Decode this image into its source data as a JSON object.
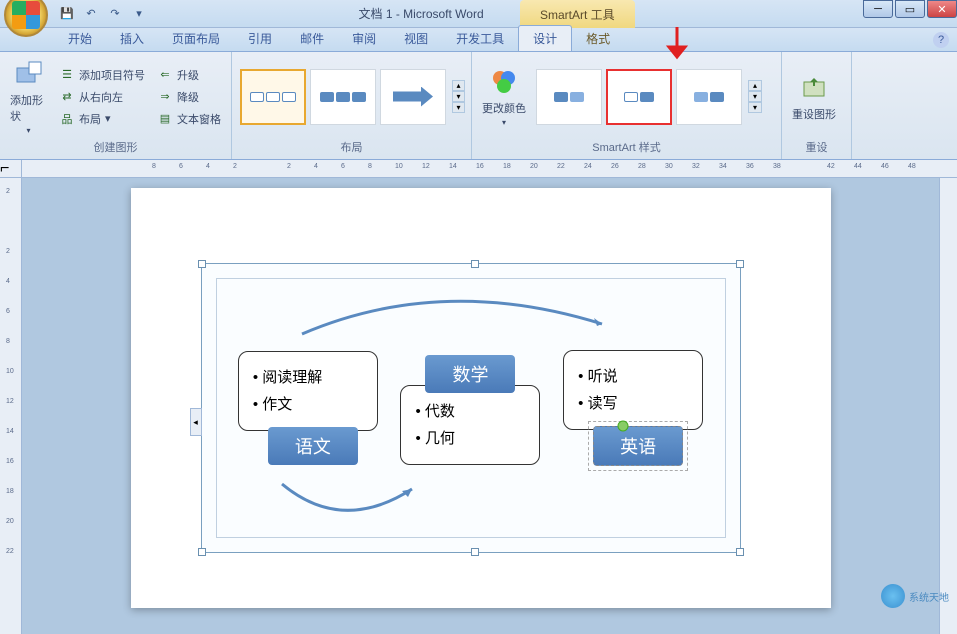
{
  "app": {
    "doc_title": "文档 1 - Microsoft Word",
    "context_tool": "SmartArt 工具"
  },
  "qat": {
    "save": "💾",
    "undo": "↶",
    "redo": "↷"
  },
  "win": {
    "min": "─",
    "max": "▭",
    "close": "✕"
  },
  "tabs": [
    "开始",
    "插入",
    "页面布局",
    "引用",
    "邮件",
    "审阅",
    "视图",
    "开发工具"
  ],
  "context_tabs": [
    "设计",
    "格式"
  ],
  "active_tab": "设计",
  "ribbon": {
    "group_create": {
      "label": "创建图形",
      "add_shape": "添加形状",
      "bullets": "添加项目符号",
      "rtl": "从右向左",
      "layout_btn": "布局",
      "promote": "升级",
      "demote": "降级",
      "text_pane": "文本窗格"
    },
    "group_layouts": {
      "label": "布局"
    },
    "group_colors": {
      "change_colors": "更改颜色"
    },
    "group_styles": {
      "label": "SmartArt 样式"
    },
    "group_reset": {
      "label": "重设",
      "reset_btn": "重设图形"
    }
  },
  "help": "?",
  "ruler_h": [
    8,
    6,
    4,
    2,
    "",
    2,
    4,
    6,
    8,
    10,
    12,
    14,
    16,
    18,
    20,
    22,
    24,
    26,
    28,
    30,
    32,
    34,
    36,
    38,
    "",
    42,
    44,
    46,
    48
  ],
  "ruler_v": [
    2,
    "",
    2,
    4,
    6,
    8,
    10,
    12,
    14,
    16,
    18,
    20,
    22
  ],
  "smartart": {
    "blocks": [
      {
        "title": "语文",
        "items": [
          "阅读理解",
          "作文"
        ]
      },
      {
        "title": "数学",
        "items": [
          "代数",
          "几何"
        ]
      },
      {
        "title": "英语",
        "items": [
          "听说",
          "读写"
        ]
      }
    ]
  },
  "watermark": "系统天地"
}
